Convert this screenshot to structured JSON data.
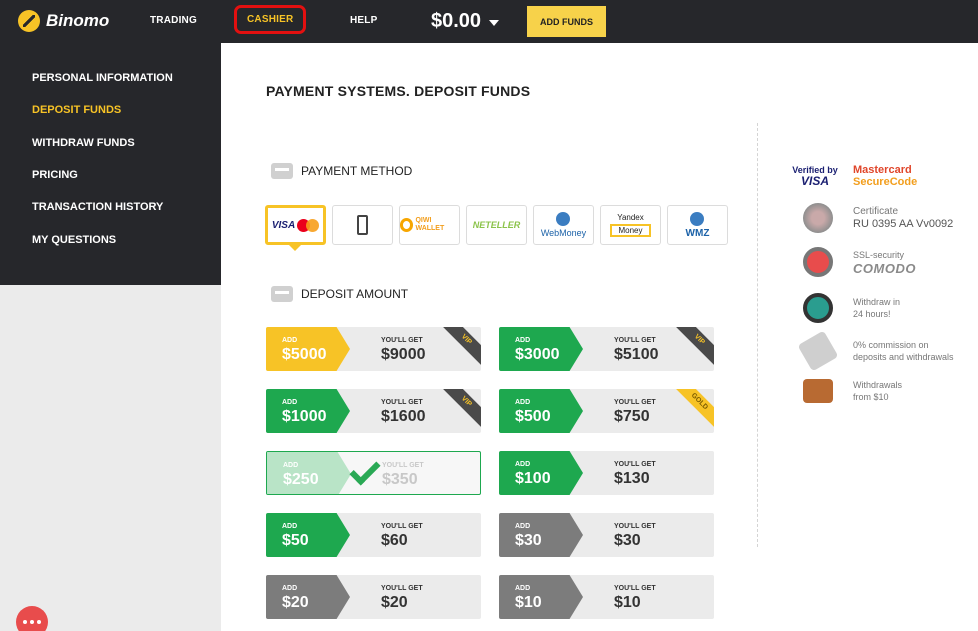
{
  "header": {
    "logo_text": "Binomo",
    "nav": [
      {
        "label": "TRADING"
      },
      {
        "label": "CASHIER"
      },
      {
        "label": "HELP"
      }
    ],
    "balance": "$0.00",
    "add_funds_label": "ADD FUNDS"
  },
  "sidebar": {
    "items": [
      {
        "label": "PERSONAL INFORMATION"
      },
      {
        "label": "DEPOSIT FUNDS",
        "active": true
      },
      {
        "label": "WITHDRAW FUNDS"
      },
      {
        "label": "PRICING"
      },
      {
        "label": "TRANSACTION HISTORY"
      },
      {
        "label": "MY QUESTIONS"
      }
    ]
  },
  "main": {
    "title": "PAYMENT SYSTEMS. DEPOSIT FUNDS",
    "payment_method_heading": "PAYMENT METHOD",
    "payment_methods": [
      {
        "id": "visa-mastercard",
        "label": "VISA",
        "selected": true
      },
      {
        "id": "mobile",
        "label": ""
      },
      {
        "id": "qiwi",
        "label": "QIWI WALLET"
      },
      {
        "id": "neteller",
        "label": "NETELLER"
      },
      {
        "id": "webmoney",
        "label": "WebMoney"
      },
      {
        "id": "yandex",
        "label": "Yandex",
        "sub": "Money"
      },
      {
        "id": "wmz",
        "label": "WMZ"
      }
    ],
    "deposit_amount_heading": "DEPOSIT AMOUNT",
    "add_label": "ADD",
    "get_label": "YOU'LL GET",
    "deposits": [
      {
        "add": "$5000",
        "get": "$9000",
        "style": "yellow",
        "badge": "VIP"
      },
      {
        "add": "$3000",
        "get": "$5100",
        "style": "green",
        "badge": "VIP"
      },
      {
        "add": "$1000",
        "get": "$1600",
        "style": "green",
        "badge": "VIP"
      },
      {
        "add": "$500",
        "get": "$750",
        "style": "green",
        "badge": "GOLD"
      },
      {
        "add": "$250",
        "get": "$350",
        "style": "green",
        "selected": true
      },
      {
        "add": "$100",
        "get": "$130",
        "style": "green"
      },
      {
        "add": "$50",
        "get": "$60",
        "style": "green"
      },
      {
        "add": "$30",
        "get": "$30",
        "style": "gray"
      },
      {
        "add": "$20",
        "get": "$20",
        "style": "gray"
      },
      {
        "add": "$10",
        "get": "$10",
        "style": "gray"
      }
    ]
  },
  "trust": {
    "visa_verified_line1": "Verified by",
    "visa_verified_line2": "VISA",
    "mc_line1": "Mastercard",
    "mc_line2": "SecureCode",
    "certificate_label": "Certificate",
    "certificate_number": "RU 0395 AA Vv0092",
    "ssl_label": "SSL-security",
    "ssl_brand": "COMODO",
    "withdraw_time_line1": "Withdraw in",
    "withdraw_time_line2": "24 hours!",
    "commission_line1": "0% commission on",
    "commission_line2": "deposits and withdrawals",
    "withdrawals_line1": "Withdrawals",
    "withdrawals_line2": "from $10"
  },
  "colors": {
    "accent": "#f7c326",
    "topbar": "#26272b",
    "green": "#1ea84f",
    "gray": "#7c7c7c",
    "highlight_border": "#e31010"
  }
}
